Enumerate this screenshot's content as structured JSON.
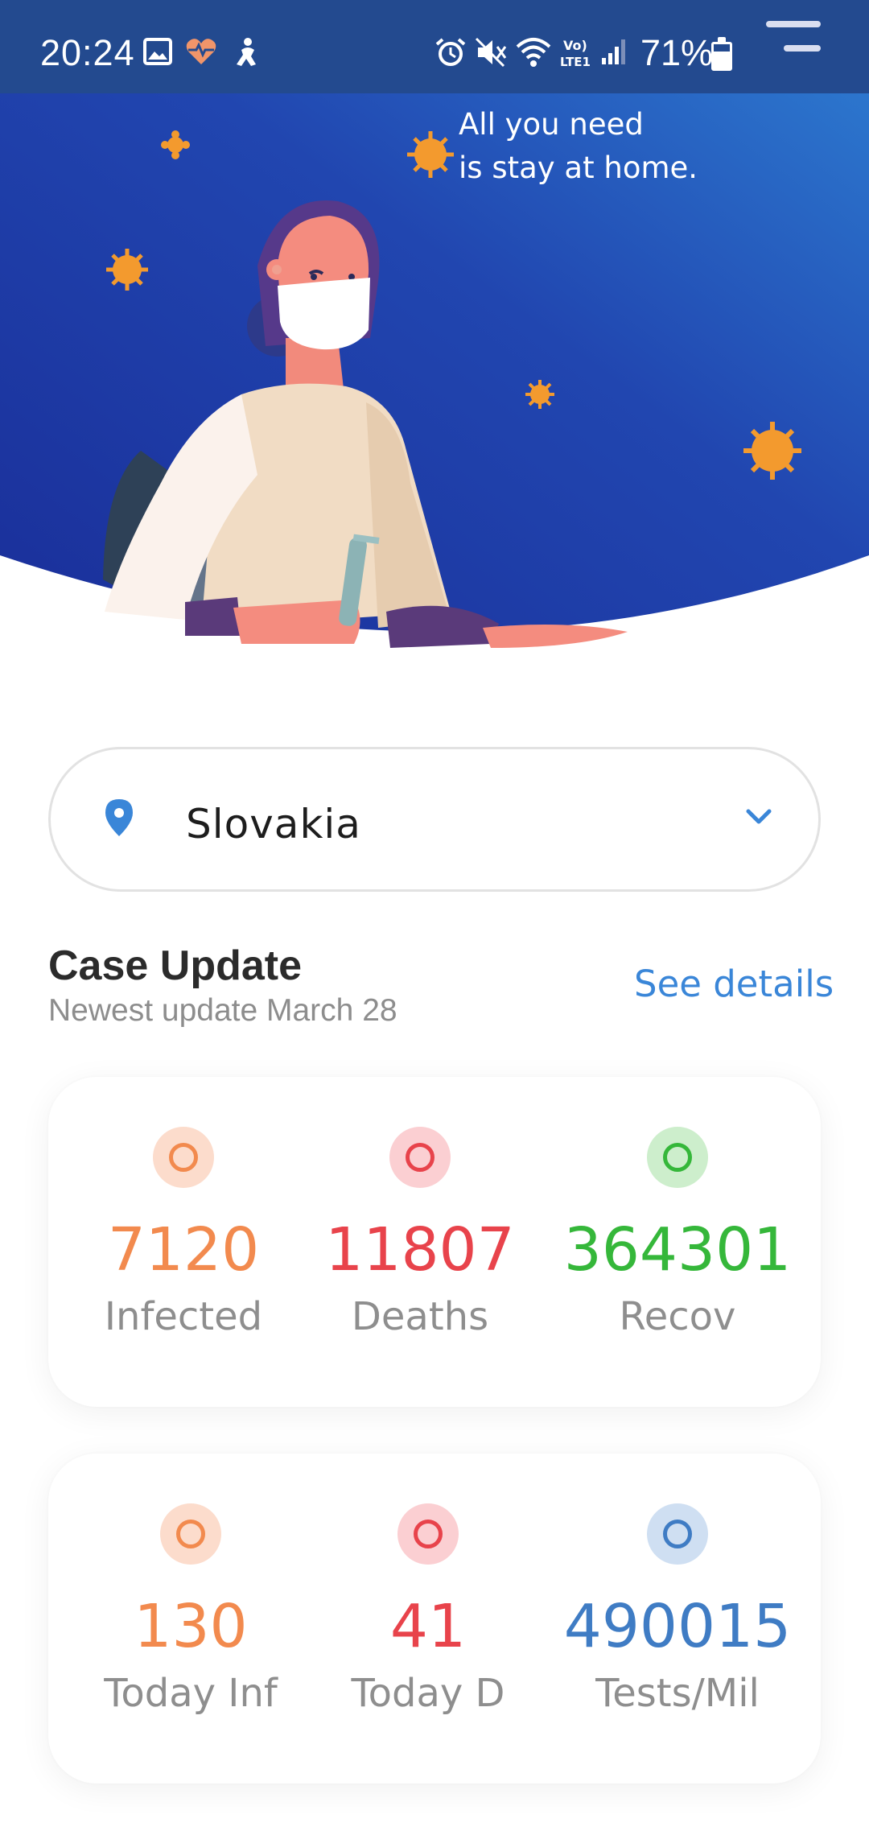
{
  "status_bar": {
    "time": "20:24",
    "battery": "71%",
    "icons": [
      "image-icon",
      "heart-rate-icon",
      "accessibility-icon",
      "alarm-icon",
      "mute-icon",
      "wifi-icon",
      "volte-icon",
      "signal-icon",
      "battery-icon"
    ]
  },
  "hero": {
    "line1": "All you need",
    "line2": "is stay at home."
  },
  "country_select": {
    "value": "Slovakia"
  },
  "case_update": {
    "title": "Case Update",
    "subtitle": "Newest update March 28",
    "see_details": "See details"
  },
  "stats_primary": [
    {
      "value": "7120",
      "label": "Infected"
    },
    {
      "value": "11807",
      "label": "Deaths"
    },
    {
      "value": "364301",
      "label": "Recov"
    }
  ],
  "stats_secondary": [
    {
      "value": "130",
      "label": "Today Inf"
    },
    {
      "value": "41",
      "label": "Today D"
    },
    {
      "value": "490015",
      "label": "Tests/Mil"
    }
  ],
  "colors": {
    "accent": "#3a86d8",
    "infected": "#f28a4e",
    "deaths": "#e8434b",
    "recovered": "#35b73a",
    "tests": "#3f7cc4",
    "hero_top": "#1b35a3",
    "hero_bottom": "#2f7ad0"
  }
}
